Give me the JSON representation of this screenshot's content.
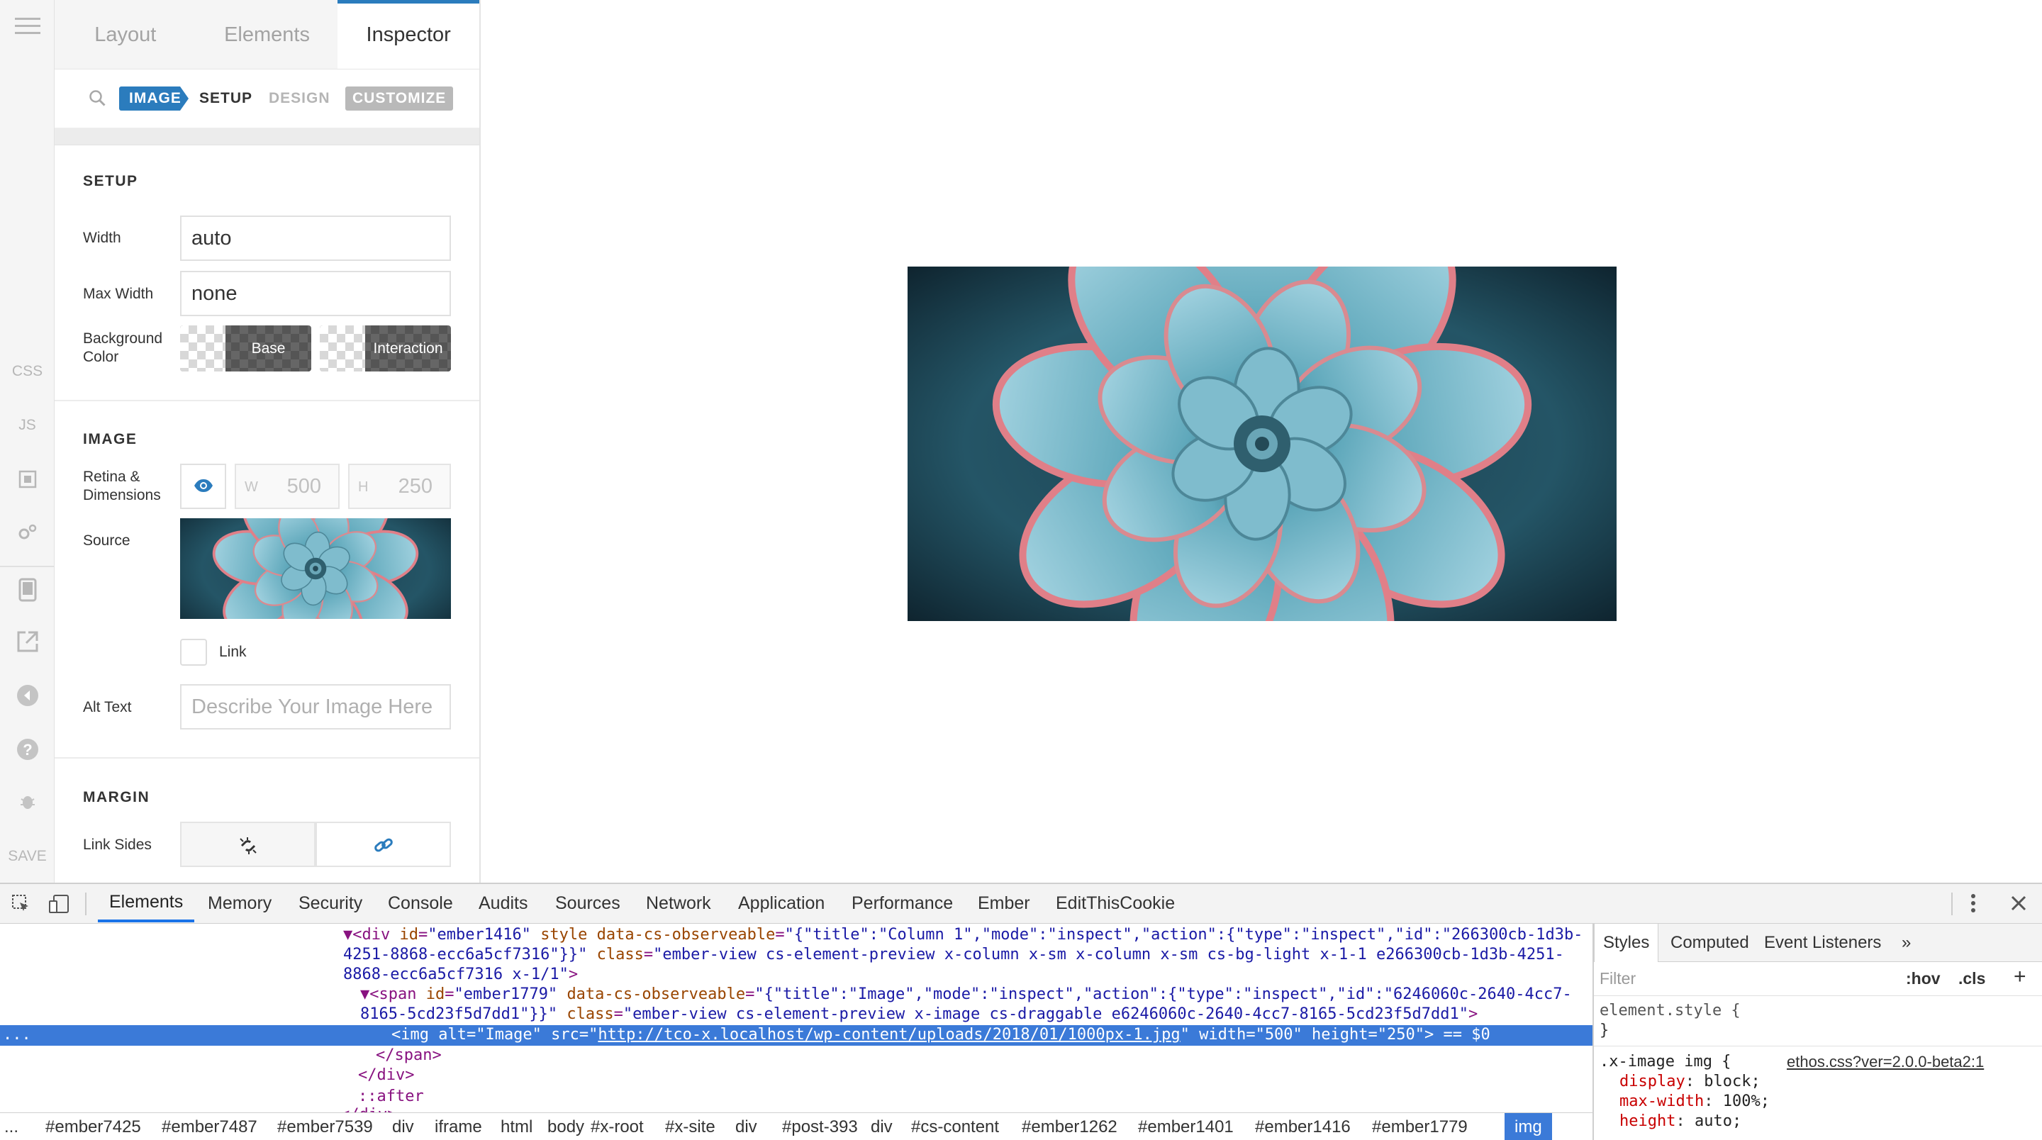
{
  "rail": {
    "css": "CSS",
    "js": "JS",
    "save": "SAVE"
  },
  "panel": {
    "tabs": [
      "Layout",
      "Elements",
      "Inspector"
    ],
    "subbar": {
      "image_chip": "IMAGE",
      "setup": "SETUP",
      "design": "DESIGN",
      "customize": "CUSTOMIZE"
    },
    "setup": {
      "title": "SETUP",
      "width_label": "Width",
      "width_value": "auto",
      "max_width_label": "Max Width",
      "max_width_value": "none",
      "bg_label_1": "Background",
      "bg_label_2": "Color",
      "bg_base": "Base",
      "bg_interaction": "Interaction"
    },
    "image": {
      "title": "IMAGE",
      "retina_label_1": "Retina &",
      "retina_label_2": "Dimensions",
      "w_label": "W",
      "w_value": "500",
      "h_label": "H",
      "h_value": "250",
      "source_label": "Source",
      "link_label": "Link",
      "alt_label": "Alt Text",
      "alt_placeholder": "Describe Your Image Here"
    },
    "margin": {
      "title": "MARGIN",
      "link_sides_label": "Link Sides"
    }
  },
  "devtools": {
    "tabs": [
      "Elements",
      "Memory",
      "Security",
      "Console",
      "Audits",
      "Sources",
      "Network",
      "Application",
      "Performance",
      "Ember",
      "EditThisCookie"
    ],
    "dom": {
      "l1_tag": "▼<div",
      "l1_id_attr": "id",
      "l1_id_val": "\"ember1416\"",
      "l1_style": "style",
      "l1_obs_attr": "data-cs-observeable",
      "l1_obs_val": "\"{\"title\":\"Column 1\",\"mode\":\"inspect\",\"action\":{\"type\":\"inspect\",\"id\":\"266300cb-1d3b-",
      "l2": "4251-8868-ecc6a5cf7316\"}}\"",
      "l2_class_attr": "class",
      "l2_class_val": "\"ember-view cs-element-preview x-column x-sm x-column x-sm cs-bg-light x-1-1 e266300cb-1d3b-4251-",
      "l3": "8868-ecc6a5cf7316 x-1/1\"",
      "l4_tag": "▼<span",
      "l4_id_val": "\"ember1779\"",
      "l4_obs_val": "\"{\"title\":\"Image\",\"mode\":\"inspect\",\"action\":{\"type\":\"inspect\",\"id\":\"6246060c-2640-4cc7-",
      "l5": "8165-5cd23f5d7dd1\"}}\"",
      "l5_class_val": "\"ember-view cs-element-preview x-image cs-draggable e6246060c-2640-4cc7-8165-5cd23f5d7dd1\"",
      "sel_dots": "...",
      "sel_line": "<img alt=\"Image\" src=\"",
      "sel_src": "http://tco-x.localhost/wp-content/uploads/2018/01/1000px-1.jpg",
      "sel_rest": "\" width=\"500\" height=\"250\"> == $0",
      "l7": "</span>",
      "l8": "</div>",
      "l9": "::after",
      "l10": "</div>"
    },
    "breadcrumbs": [
      "...",
      "#ember7425",
      "#ember7487",
      "#ember7539",
      "div",
      "iframe",
      "html",
      "body",
      "#x-root",
      "#x-site",
      "div",
      "#post-393",
      "div",
      "#cs-content",
      "#ember1262",
      "#ember1401",
      "#ember1416",
      "#ember1779",
      "img"
    ],
    "styles": {
      "tabs": [
        "Styles",
        "Computed",
        "Event Listeners"
      ],
      "more": "»",
      "filter_placeholder": "Filter",
      "hov": ":hov",
      "cls": ".cls",
      "plus": "+",
      "rule1_selector": "element.style {",
      "rule1_close": "}",
      "rule2_selector": ".x-image img {",
      "rule2_source": "ethos.css?ver=2.0.0-beta2:1",
      "rule2_decls": [
        {
          "prop": "display",
          "val": "block;"
        },
        {
          "prop": "max-width",
          "val": "100%;"
        },
        {
          "prop": "height",
          "val": "auto;"
        }
      ]
    }
  }
}
